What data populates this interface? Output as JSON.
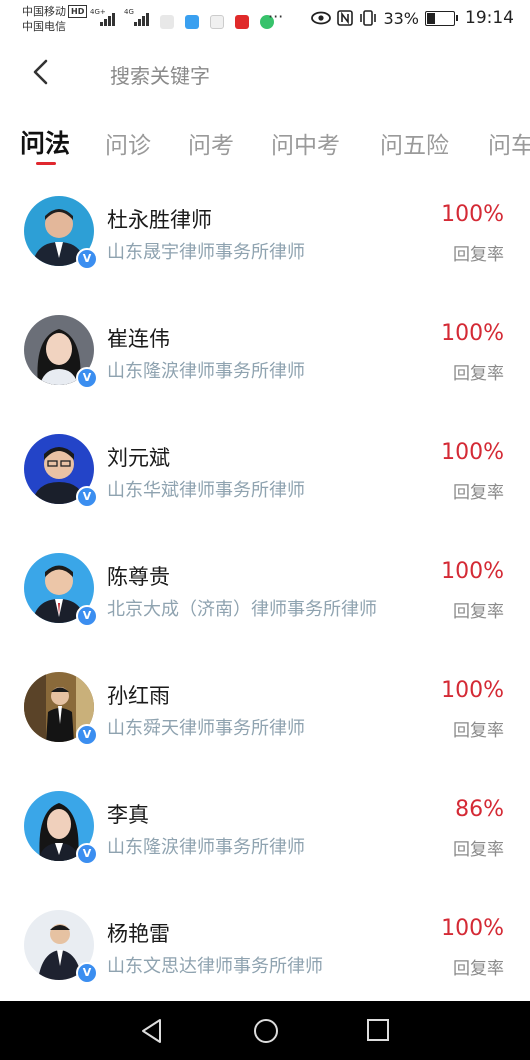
{
  "status_bar": {
    "carrier_1": "中国移动",
    "carrier_2": "中国电信",
    "hd_label": "HD",
    "net_1": "4G+",
    "net_2": "4G",
    "more": "···",
    "battery_percent": "33%",
    "battery_level": 0.33,
    "time": "19:14"
  },
  "header": {
    "search_placeholder": "搜索关键字"
  },
  "tabs": [
    {
      "label": "问法",
      "active": true
    },
    {
      "label": "问诊",
      "active": false
    },
    {
      "label": "问考",
      "active": false
    },
    {
      "label": "问中考",
      "active": false
    },
    {
      "label": "问五险",
      "active": false
    },
    {
      "label": "问车",
      "active": false
    }
  ],
  "lawyers": [
    {
      "name": "杜永胜律师",
      "firm": "山东晟宇律师事务所律师",
      "rate": "100%",
      "rate_label": "回复率",
      "avatar_bg": "#2d9fd6"
    },
    {
      "name": "崔连伟",
      "firm": "山东隆涙律师事务所律师",
      "rate": "100%",
      "rate_label": "回复率",
      "avatar_bg": "#6b6f78"
    },
    {
      "name": "刘元斌",
      "firm": "山东华斌律师事务所律师",
      "rate": "100%",
      "rate_label": "回复率",
      "avatar_bg": "#2344c8"
    },
    {
      "name": "陈尊贵",
      "firm": "北京大成（济南）律师事务所律师",
      "rate": "100%",
      "rate_label": "回复率",
      "avatar_bg": "#3aa6e8"
    },
    {
      "name": "孙红雨",
      "firm": "山东舜天律师事务所律师",
      "rate": "100%",
      "rate_label": "回复率",
      "avatar_bg": "#8a6a3a"
    },
    {
      "name": "李真",
      "firm": "山东隆涙律师事务所律师",
      "rate": "86%",
      "rate_label": "回复率",
      "avatar_bg": "#3aa6e8"
    },
    {
      "name": "杨艳雷",
      "firm": "山东文思达律师事务所律师",
      "rate": "100%",
      "rate_label": "回复率",
      "avatar_bg": "#e9edf2"
    }
  ],
  "verified_mark": "V",
  "colors": {
    "accent": "#e0272e",
    "rate": "#d42a35",
    "firm_text": "#8fa3b0",
    "verified": "#3b8ef0"
  },
  "icons": {
    "back": "chevron-left-icon",
    "nav_back": "triangle-back-icon",
    "nav_home": "circle-home-icon",
    "nav_recent": "square-recent-icon"
  }
}
